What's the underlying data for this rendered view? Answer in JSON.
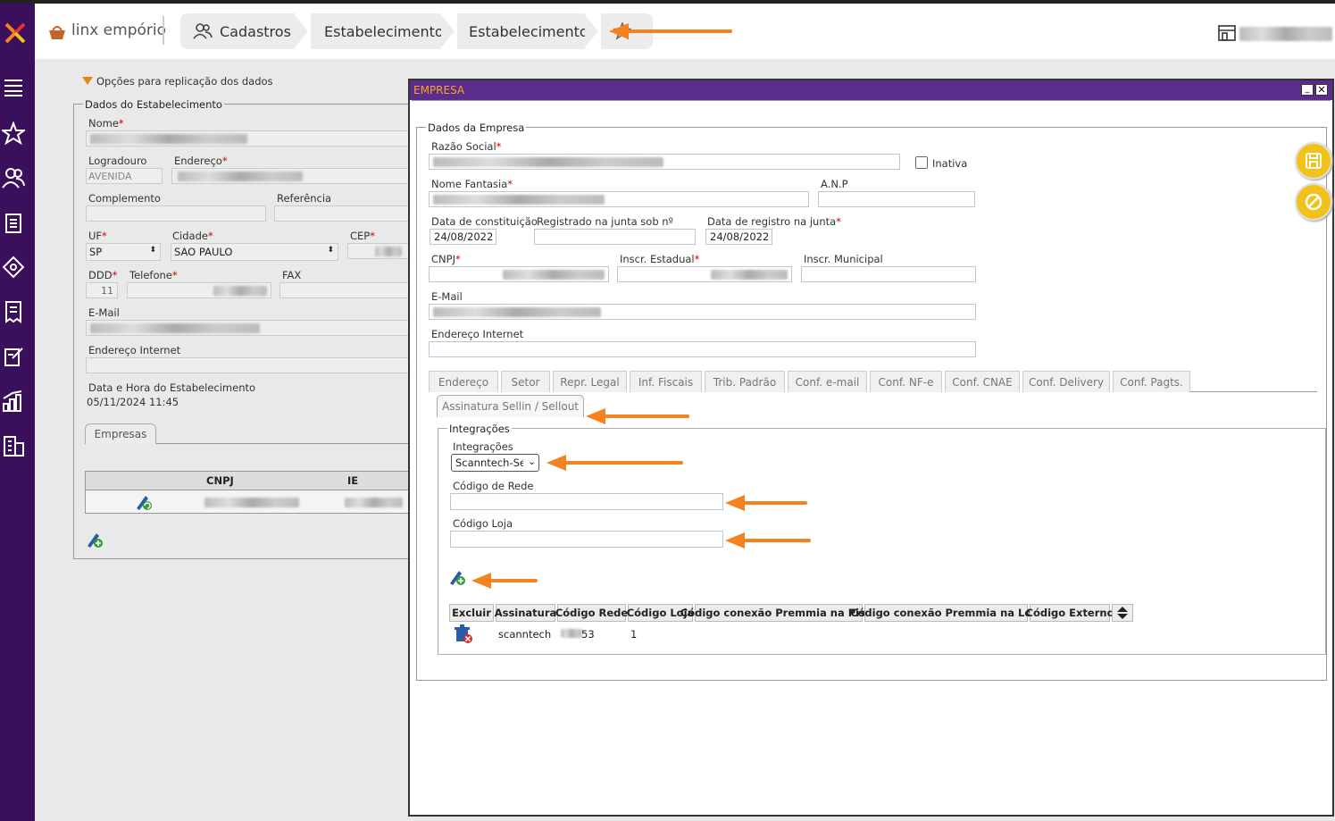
{
  "app": {
    "logo_text": "linx empório"
  },
  "breadcrumb": [
    "Cadastros",
    "Estabelecimento",
    "Estabelecimento"
  ],
  "background_form": {
    "replication_label": "Opções para replicação dos dados",
    "section_title": "Dados do Estabelecimento",
    "labels": {
      "nome": "Nome",
      "logradouro": "Logradouro",
      "endereco": "Endereço",
      "complemento": "Complemento",
      "referencia": "Referência",
      "uf": "UF",
      "cidade": "Cidade",
      "cep": "CEP",
      "ddd": "DDD",
      "telefone": "Telefone",
      "fax": "FAX",
      "email": "E-Mail",
      "endereco_internet": "Endereço Internet",
      "data_hora": "Data e Hora do Estabelecimento"
    },
    "values": {
      "logradouro": "AVENIDA",
      "uf": "SP",
      "cidade": "SAO PAULO",
      "ddd": "11",
      "data_hora": "05/11/2024 11:45"
    },
    "tab_empresas": "Empresas",
    "table_headers": [
      "CNPJ",
      "IE"
    ]
  },
  "modal": {
    "title": "EMPRESA",
    "section_title": "Dados da Empresa",
    "labels": {
      "razao_social": "Razão Social",
      "inativa": "Inativa",
      "nome_fantasia": "Nome Fantasia",
      "anp": "A.N.P",
      "data_constituicao": "Data de constituição",
      "registrado_junta": "Registrado na junta sob nº",
      "data_registro_junta": "Data de registro na junta",
      "cnpj": "CNPJ",
      "inscr_estadual": "Inscr. Estadual",
      "inscr_municipal": "Inscr. Municipal",
      "email": "E-Mail",
      "endereco_internet": "Endereço Internet"
    },
    "values": {
      "data_constituicao": "24/08/2022",
      "data_registro_junta": "24/08/2022"
    },
    "tabs": [
      "Endereço",
      "Setor",
      "Repr. Legal",
      "Inf. Fiscais",
      "Trib. Padrão",
      "Conf. e-mail",
      "Conf. NF-e",
      "Conf. CNAE",
      "Conf. Delivery",
      "Conf. Pagts."
    ],
    "active_tab": "Assinatura Sellin / Sellout",
    "integracoes": {
      "section_title": "Integrações",
      "select_label": "Integrações",
      "select_value": "Scanntech-Sellout",
      "codigo_rede_label": "Código de Rede",
      "codigo_loja_label": "Código Loja"
    },
    "table": {
      "headers": [
        "Excluir",
        "Assinatura",
        "Código Rede",
        "Código Loja",
        "Código conexão Premmia na Pista",
        "Código conexão Premmia na Loja",
        "Código Externo"
      ],
      "rows": [
        {
          "assinatura": "scanntech",
          "codigo_rede": "53",
          "codigo_loja": "1"
        }
      ]
    }
  },
  "colors": {
    "sidebar": "#3a0f5c",
    "modal_title": "#5a2d8c",
    "accent": "#f58220",
    "action_button": "#f2c21b"
  }
}
